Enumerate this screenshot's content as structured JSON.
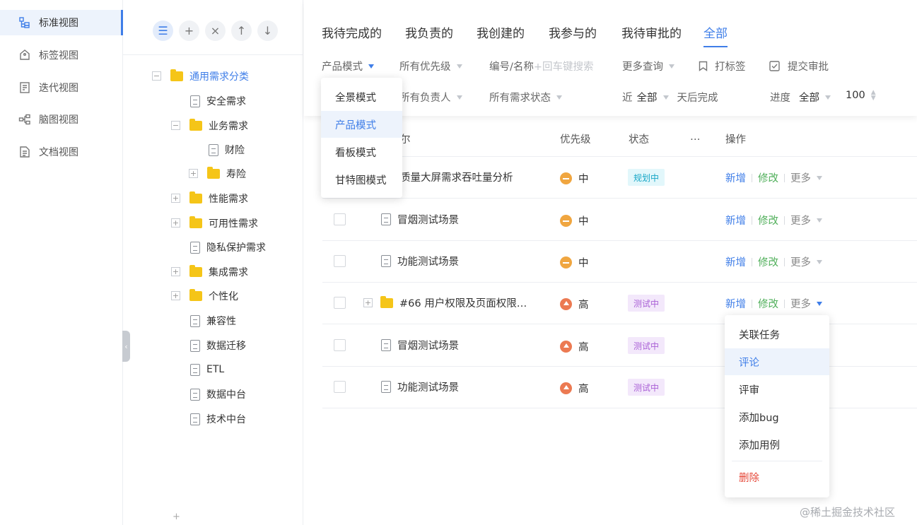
{
  "sidebar": {
    "items": [
      {
        "label": "标准视图",
        "icon": "tree-structure-icon",
        "active": true
      },
      {
        "label": "标签视图",
        "icon": "tag-icon"
      },
      {
        "label": "迭代视图",
        "icon": "iteration-icon"
      },
      {
        "label": "脑图视图",
        "icon": "mindmap-icon"
      },
      {
        "label": "文档视图",
        "icon": "document-icon"
      }
    ]
  },
  "tree": {
    "tools": [
      "list-icon",
      "plus-icon",
      "close-icon",
      "arrow-up-icon",
      "arrow-down-icon"
    ],
    "nodes": [
      {
        "label": "通用需求分类",
        "type": "folder",
        "toggle": "−"
      },
      {
        "label": "安全需求",
        "type": "doc"
      },
      {
        "label": "业务需求",
        "type": "folder",
        "toggle": "−"
      },
      {
        "label": "财险",
        "type": "doc"
      },
      {
        "label": "寿险",
        "type": "folder",
        "toggle": "+"
      },
      {
        "label": "性能需求",
        "type": "folder",
        "toggle": "+"
      },
      {
        "label": "可用性需求",
        "type": "folder",
        "toggle": "+"
      },
      {
        "label": "隐私保护需求",
        "type": "doc"
      },
      {
        "label": "集成需求",
        "type": "folder",
        "toggle": "+"
      },
      {
        "label": "个性化",
        "type": "folder",
        "toggle": "+"
      },
      {
        "label": "兼容性",
        "type": "doc"
      },
      {
        "label": "数据迁移",
        "type": "doc"
      },
      {
        "label": "ETL",
        "type": "doc"
      },
      {
        "label": "数据中台",
        "type": "doc"
      },
      {
        "label": "技术中台",
        "type": "doc"
      }
    ],
    "bottom_add": "+"
  },
  "tabs": [
    "我待完成的",
    "我负责的",
    "我创建的",
    "我参与的",
    "我待审批的",
    "全部"
  ],
  "filters": {
    "mode": "产品模式",
    "priority": "所有优先级",
    "search_label": "编号/名称",
    "search_placeholder": "+回车键搜索",
    "more_query": "更多查询",
    "tag": "打标签",
    "submit_approval": "提交审批",
    "owner": "所有负责人",
    "status": "所有需求状态",
    "near_label": "近",
    "near_value": "全部",
    "days_suffix": "天后完成",
    "progress_label": "进度",
    "progress_value": "全部",
    "page_size": "100"
  },
  "mode_dropdown": [
    "全景模式",
    "产品模式",
    "看板模式",
    "甘特图模式"
  ],
  "table": {
    "headers": {
      "name_tail": "尔",
      "priority": "优先级",
      "status": "状态",
      "ellipsis": "…",
      "ops": "操作"
    },
    "rows": [
      {
        "name": "质量大屏需求吞吐量分析",
        "priority": "中",
        "level": "mid",
        "status": "规划中",
        "status_type": "plan"
      },
      {
        "name": "冒烟测试场景",
        "priority": "中",
        "level": "mid",
        "status": "",
        "status_type": ""
      },
      {
        "name": "功能测试场景",
        "priority": "中",
        "level": "mid",
        "status": "",
        "status_type": ""
      },
      {
        "name": "#66 用户权限及页面权限…",
        "priority": "高",
        "level": "high",
        "status": "测试中",
        "status_type": "test"
      },
      {
        "name": "冒烟测试场景",
        "priority": "高",
        "level": "high",
        "status": "测试中",
        "status_type": "test"
      },
      {
        "name": "功能测试场景",
        "priority": "高",
        "level": "high",
        "status": "测试中",
        "status_type": "test"
      }
    ],
    "op_add": "新增",
    "op_edit": "修改",
    "op_more": "更多"
  },
  "more_dropdown": [
    "关联任务",
    "评论",
    "评审",
    "添加bug",
    "添加用例",
    "删除"
  ],
  "watermark": "@稀土掘金技术社区",
  "colors": {
    "accent": "#3f7ee8",
    "folder": "#f5c518",
    "mid": "#f0a640",
    "high": "#ec7a52",
    "edit": "#52b05c",
    "danger": "#e64a3b"
  }
}
